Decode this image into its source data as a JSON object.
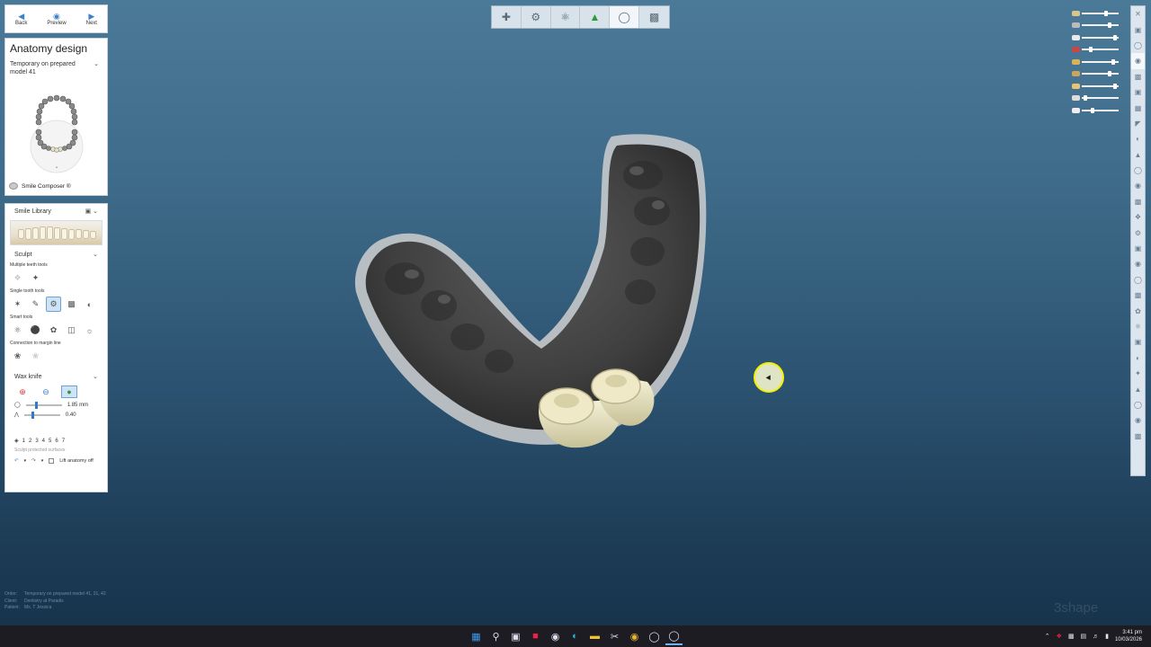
{
  "nav": {
    "back": "Back",
    "preview": "Preview",
    "next": "Next"
  },
  "design": {
    "title": "Anatomy design",
    "subtitle": "Temporary on prepared model 41",
    "smile_composer": "Smile Composer ®"
  },
  "library": {
    "label": "Smile Library"
  },
  "sculpt": {
    "label": "Sculpt",
    "multiple_teeth": "Multiple teeth tools",
    "single_tooth": "Single tooth tools",
    "smart_tools": "Smart tools",
    "connection": "Connection to margin line"
  },
  "wax": {
    "label": "Wax knife",
    "size_value": "1.85 mm",
    "strength_value": "0.40",
    "size_level": 0.25,
    "strength_level": 0.2,
    "steps": [
      "1",
      "2",
      "3",
      "4",
      "5",
      "6",
      "7"
    ],
    "protect_label": "Sculpt protected surfaces",
    "lift_label": "Lift anatomy off"
  },
  "order": {
    "order_key": "Order:",
    "order_val": "Temporary on prepared model 41, 31, 42",
    "client_key": "Client:",
    "client_val": "Dentistry at Paradis",
    "patient_key": "Patient:",
    "patient_val": "Ms. T Jessica"
  },
  "watermark": "3shape",
  "clock": {
    "time": "3:41 pm",
    "date": "10/03/2026"
  },
  "colors": {
    "accent": "#3b83c9",
    "cursor_ring": "#f3f000",
    "background_top": "#4b7a98",
    "background_bottom": "#16324a"
  },
  "icons": {
    "toolbar": [
      "margin-line-icon",
      "model-icon",
      "bite-icon",
      "scan-icon",
      "tooth-icon",
      "die-icon"
    ],
    "sidebar_count": 28
  }
}
